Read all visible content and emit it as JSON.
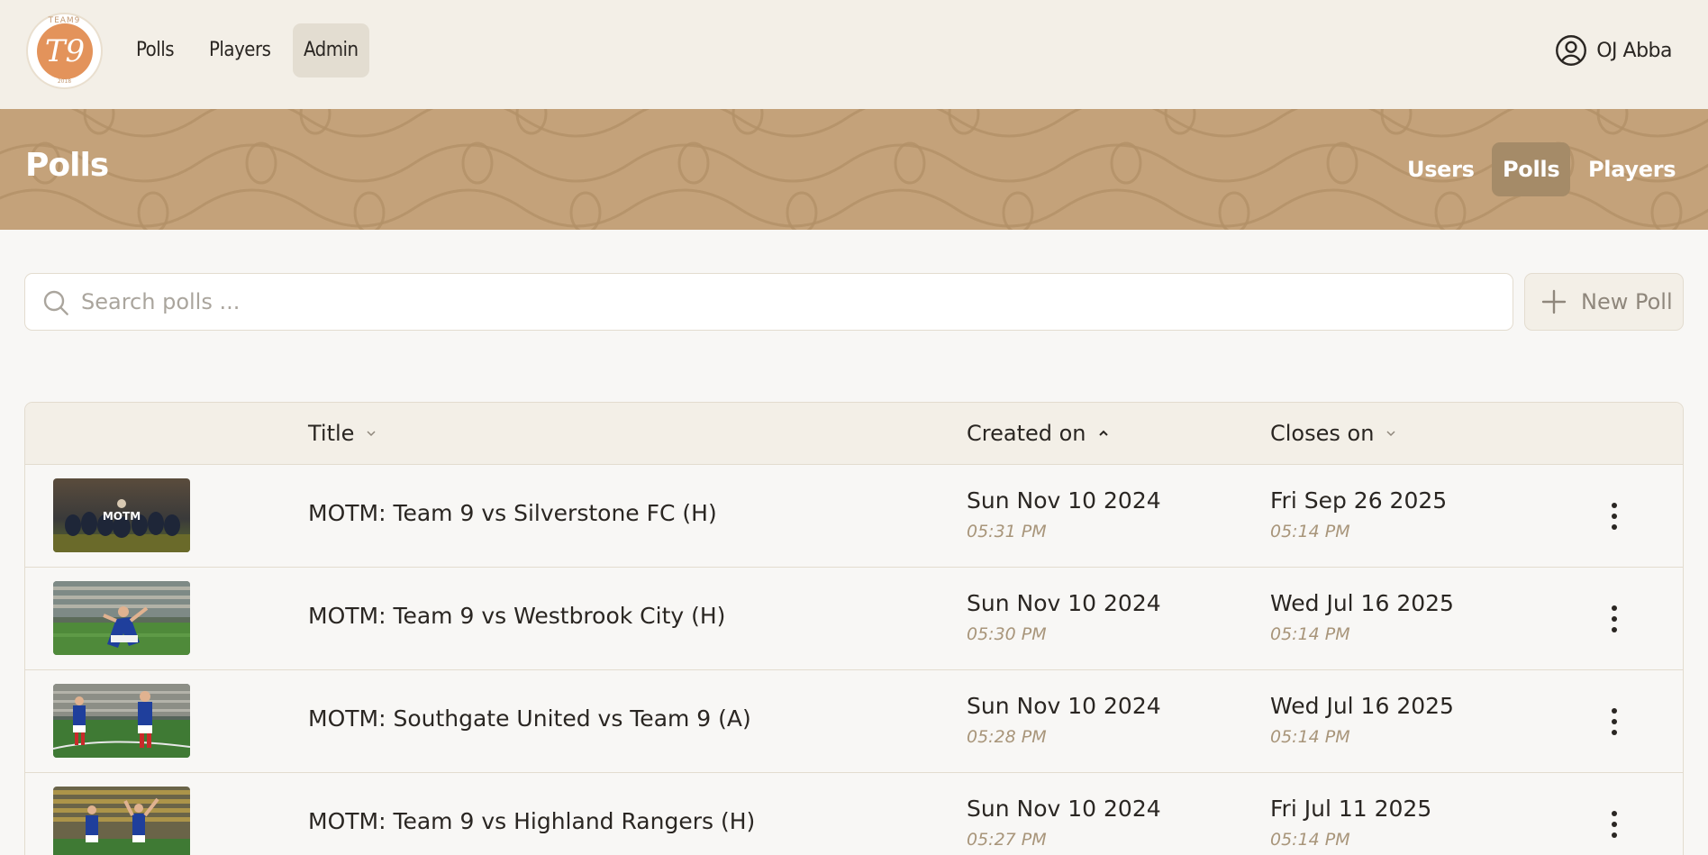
{
  "brand": {
    "logo_text": "T9",
    "logo_top_text": "TEAM9",
    "logo_bottom_text": "2018"
  },
  "topnav": {
    "items": [
      {
        "label": "Polls",
        "active": false
      },
      {
        "label": "Players",
        "active": false
      },
      {
        "label": "Admin",
        "active": true
      }
    ],
    "user_name": "OJ Abba",
    "user_icon": "user-circle-icon"
  },
  "banner": {
    "title": "Polls",
    "tabs": [
      {
        "label": "Users",
        "active": false
      },
      {
        "label": "Polls",
        "active": true
      },
      {
        "label": "Players",
        "active": false
      }
    ]
  },
  "search": {
    "placeholder": "Search polls ...",
    "value": "",
    "icon": "search-icon"
  },
  "new_poll_button": {
    "label": "New Poll",
    "icon": "plus-icon"
  },
  "table": {
    "columns": [
      {
        "label": "Title",
        "sort": "none"
      },
      {
        "label": "Created on",
        "sort": "ascending"
      },
      {
        "label": "Closes on",
        "sort": "none"
      }
    ],
    "rows": [
      {
        "thumbnail_text": "MOTM",
        "title": "MOTM: Team 9 vs Silverstone FC (H)",
        "created_date": "Sun Nov 10 2024",
        "created_time": "05:31 PM",
        "closes_date": "Fri Sep 26 2025",
        "closes_time": "05:14 PM"
      },
      {
        "thumbnail_text": "",
        "title": "MOTM: Team 9 vs Westbrook City (H)",
        "created_date": "Sun Nov 10 2024",
        "created_time": "05:30 PM",
        "closes_date": "Wed Jul 16 2025",
        "closes_time": "05:14 PM"
      },
      {
        "thumbnail_text": "",
        "title": "MOTM: Southgate United vs Team 9 (A)",
        "created_date": "Sun Nov 10 2024",
        "created_time": "05:28 PM",
        "closes_date": "Wed Jul 16 2025",
        "closes_time": "05:14 PM"
      },
      {
        "thumbnail_text": "",
        "title": "MOTM: Team 9 vs Highland Rangers (H)",
        "created_date": "Sun Nov 10 2024",
        "created_time": "05:27 PM",
        "closes_date": "Fri Jul 11 2025",
        "closes_time": "05:14 PM"
      }
    ]
  },
  "colors": {
    "accent_orange": "#e3935b",
    "banner_tan": "#c4a27a",
    "active_tab": "#a58b68",
    "topnav_bg": "#f3efe7",
    "muted_time": "#a8957a"
  }
}
